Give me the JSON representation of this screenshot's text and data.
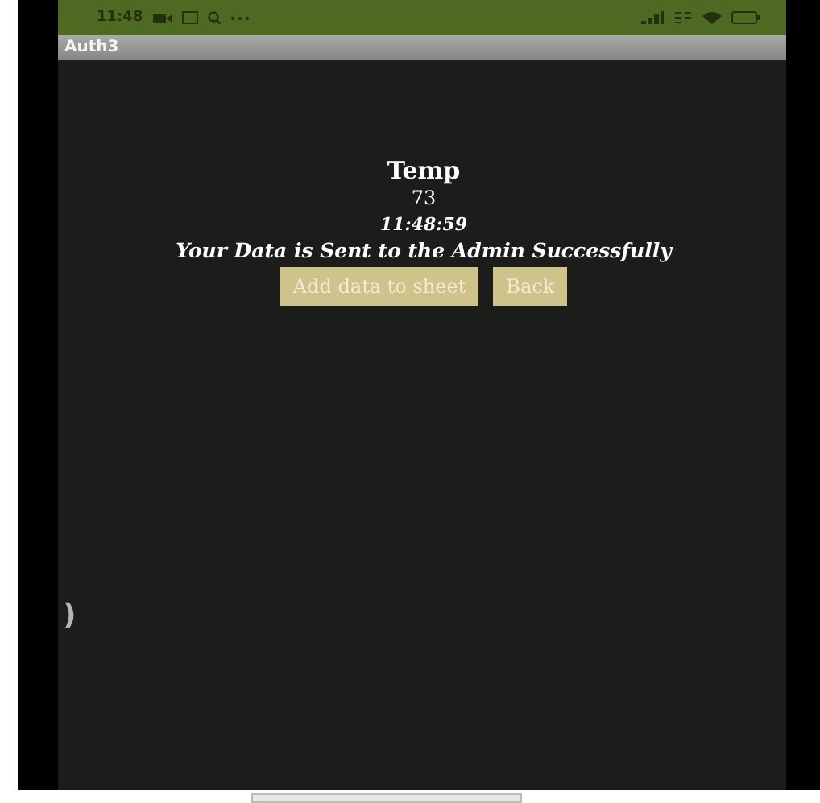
{
  "status_bar": {
    "time": "11:48"
  },
  "window": {
    "title": "Auth3"
  },
  "content": {
    "label": "Temp",
    "value": "73",
    "time": "11:48:59",
    "message": "Your Data is Sent to the Admin Successfully"
  },
  "buttons": [
    {
      "label": "Add data to sheet"
    },
    {
      "label": "Back"
    }
  ],
  "stray_text": ")"
}
